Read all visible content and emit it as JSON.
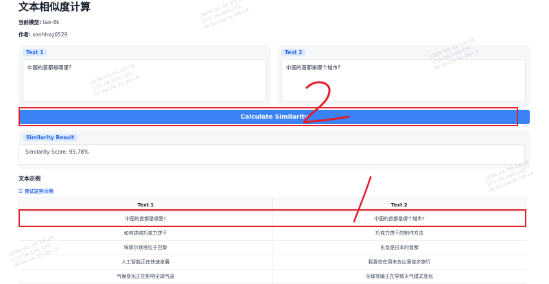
{
  "app": {
    "title": "文本相似度计算",
    "model_label": "当前模型:",
    "model_value": "tao-8k",
    "author_label": "作者:",
    "author_value": "sonhhxg0529"
  },
  "inputs": {
    "text1_label": "Text 1",
    "text1_value": "中国的首都是哪里?",
    "text2_label": "Text 2",
    "text2_value": "中国的首都是哪个城市?"
  },
  "action": {
    "calculate_label": "Calculate Similarity"
  },
  "result": {
    "label": "Similarity Result",
    "value": "Similarity Score: 95.78%"
  },
  "examples": {
    "section_title": "文本示例",
    "try_link": "尝试这些示例",
    "columns": [
      "Text 1",
      "Text 2"
    ],
    "rows": [
      [
        "中国的首都是哪里?",
        "中国的首都是哪个城市?"
      ],
      [
        "如何烘焙巧克力饼干",
        "巧克力饼干的制作方法"
      ],
      [
        "埃菲尔铁塔位于巴黎",
        "东京是日本的首都"
      ],
      [
        "人工智能正在快速发展",
        "我喜欢在周末去山里徒步旅行"
      ],
      [
        "气候变化正在影响全球气温",
        "全球变暖正在导致天气模式变化"
      ]
    ]
  },
  "annotations": {
    "mark_1": "1",
    "mark_2": "2",
    "color": "#e11d2a"
  },
  "watermark": {
    "line1": "2026-01-30 15:18",
    "line2": "172.16.106.152",
    "line3": "f8-8e-04-2c-29-c4"
  },
  "colors": {
    "accent": "#3b82f6",
    "badge_bg": "#dbeafe",
    "badge_text": "#2563eb",
    "highlight": "#e11d2a"
  }
}
